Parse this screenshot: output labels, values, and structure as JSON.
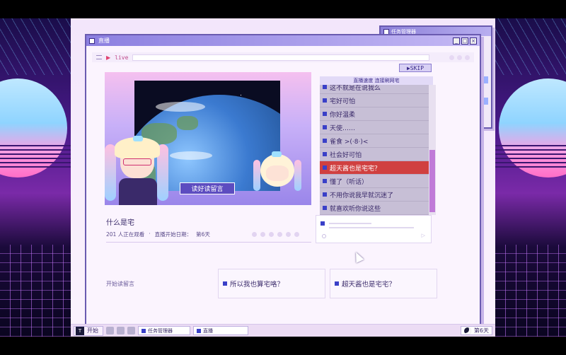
{
  "window": {
    "title": "直播"
  },
  "taskmgr": {
    "title": "任务管理器"
  },
  "addressbar": {
    "live_label": "live"
  },
  "stream": {
    "title": "什么是宅",
    "viewers": "201 人正在观看",
    "separator": "·",
    "start_label": "直播开始日期：",
    "day": "第6天",
    "read_button": "读好读留言"
  },
  "skip_label": "SKIP",
  "chat": {
    "tab_label": "直播速度 连接刷网宅",
    "messages": [
      {
        "text": "这不就是在说我么"
      },
      {
        "text": "宅好可怕"
      },
      {
        "text": "你好温柔"
      },
      {
        "text": "天使……"
      },
      {
        "text": "雀食 >(·8·)<"
      },
      {
        "text": "社会好可怕"
      },
      {
        "text": "超天酱也是宅宅？",
        "highlight": true
      },
      {
        "text": "懂了（听话）"
      },
      {
        "text": "不用你说我早就沉迷了"
      },
      {
        "text": "就喜欢听你说这些"
      }
    ],
    "scroll_position": 0.75
  },
  "start_reading": "开始读留言",
  "choices": [
    "所以我也算宅咯？",
    "超天酱也是宅宅？"
  ],
  "progress": 0.05,
  "taskbar": {
    "start": "开始",
    "logo": "T",
    "tasks": [
      "任务管理器",
      "直播"
    ],
    "day": "第6天"
  },
  "colors": {
    "accent": "#5c4cc0",
    "highlight": "#d04040",
    "bullet": "#3a40c8"
  }
}
